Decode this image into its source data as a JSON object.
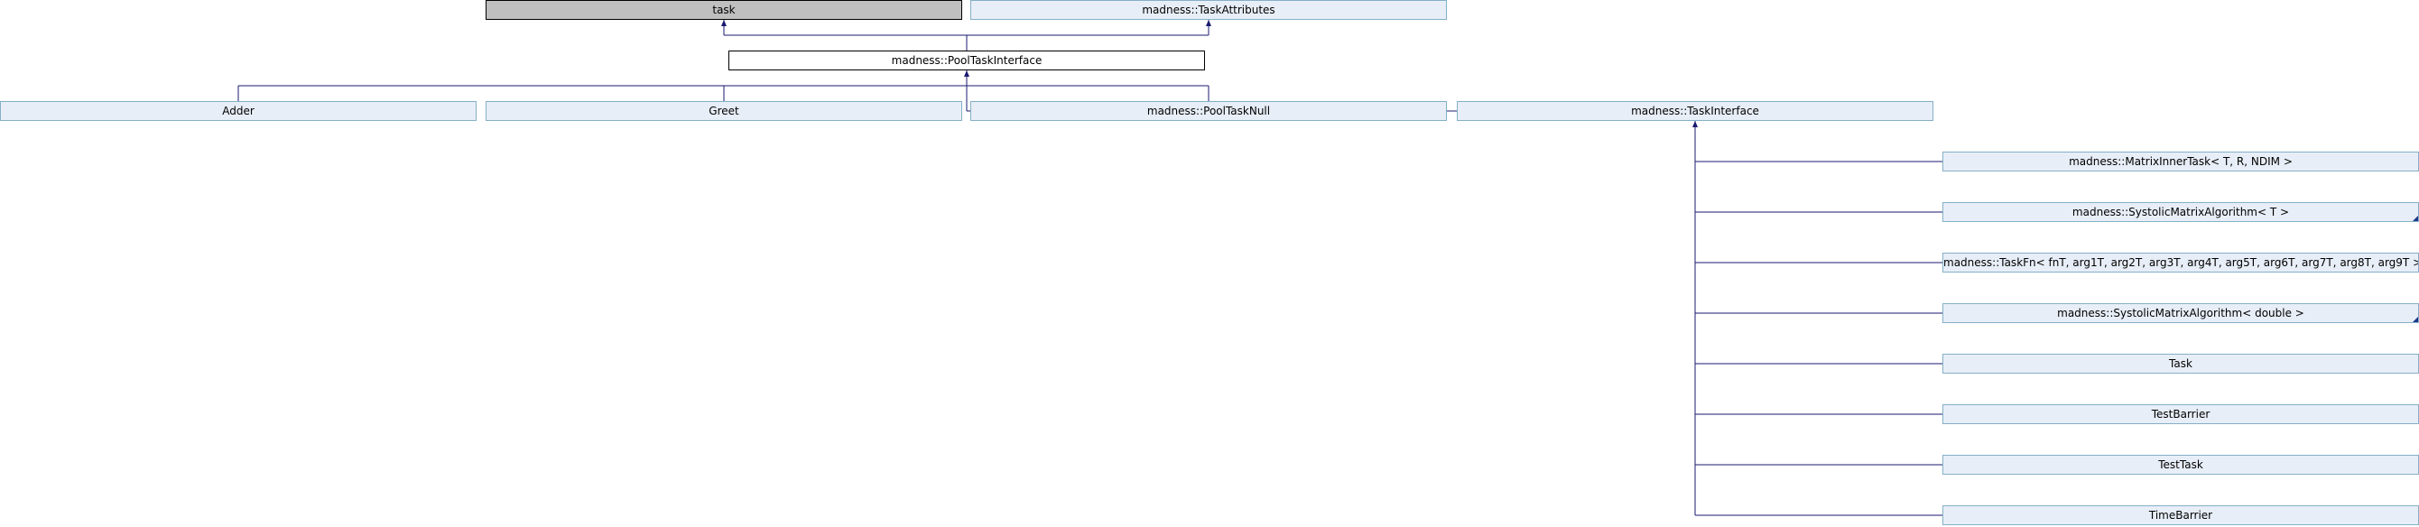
{
  "nodes": {
    "task": "task",
    "task_attributes": "madness::TaskAttributes",
    "pool_task_interface": "madness::PoolTaskInterface",
    "adder": "Adder",
    "greet": "Greet",
    "pool_task_null": "madness::PoolTaskNull",
    "task_interface": "madness::TaskInterface",
    "matrix_inner_task": "madness::MatrixInnerTask< T, R, NDIM >",
    "systolic_t": "madness::SystolicMatrixAlgorithm< T >",
    "task_fn": "madness::TaskFn< fnT, arg1T, arg2T, arg3T, arg4T, arg5T, arg6T, arg7T, arg8T, arg9T >",
    "systolic_double": "madness::SystolicMatrixAlgorithm< double >",
    "task_class": "Task",
    "test_barrier": "TestBarrier",
    "test_task": "TestTask",
    "time_barrier": "TimeBarrier"
  },
  "edges": [
    {
      "from": "pool_task_interface",
      "to": "task"
    },
    {
      "from": "pool_task_interface",
      "to": "task_attributes"
    },
    {
      "from": "adder",
      "to": "pool_task_interface"
    },
    {
      "from": "greet",
      "to": "pool_task_interface"
    },
    {
      "from": "pool_task_null",
      "to": "pool_task_interface"
    },
    {
      "from": "task_interface",
      "to": "pool_task_interface"
    },
    {
      "from": "matrix_inner_task",
      "to": "task_interface"
    },
    {
      "from": "systolic_t",
      "to": "task_interface"
    },
    {
      "from": "task_fn",
      "to": "task_interface"
    },
    {
      "from": "systolic_double",
      "to": "task_interface"
    },
    {
      "from": "task_class",
      "to": "task_interface"
    },
    {
      "from": "test_barrier",
      "to": "task_interface"
    },
    {
      "from": "test_task",
      "to": "task_interface"
    },
    {
      "from": "time_barrier",
      "to": "task_interface"
    }
  ],
  "colors": {
    "edge": "#191970",
    "node_fill": "#e8eef7",
    "node_border": "#84b0c7",
    "external_fill": "#bfbfbf",
    "focus_fill": "#ffffff"
  }
}
